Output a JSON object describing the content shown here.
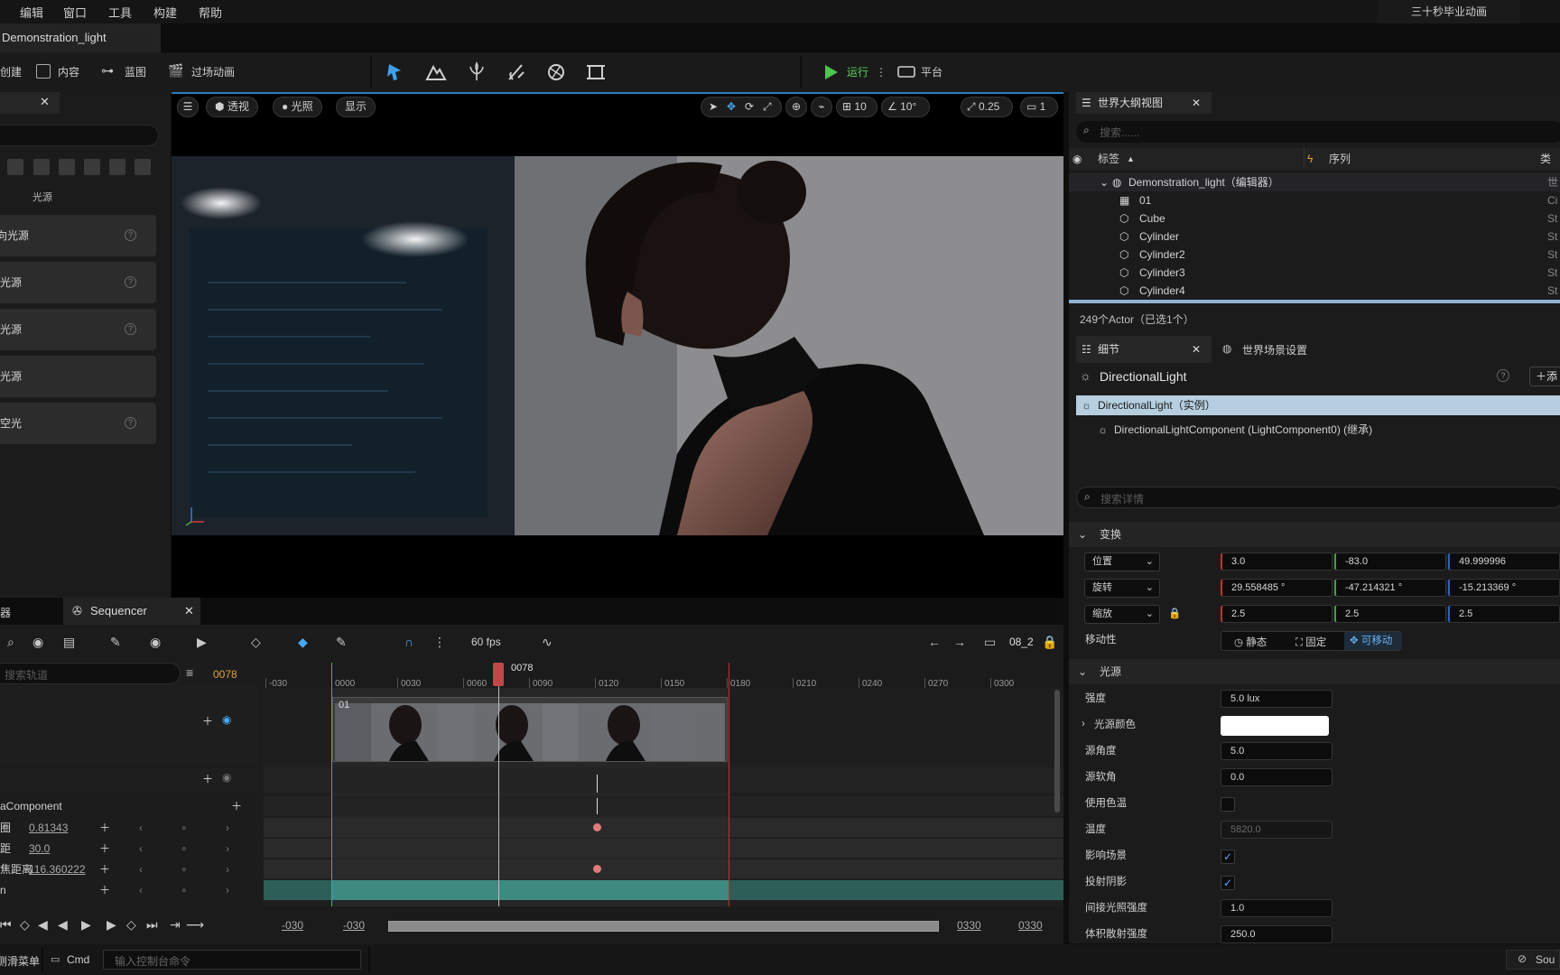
{
  "menu": {
    "items": [
      "编辑",
      "窗口",
      "工具",
      "构建",
      "帮助"
    ],
    "project_name": "三十秒毕业动画"
  },
  "document_tab": {
    "title": "Demonstration_light"
  },
  "toolbar": {
    "create_label": "创建",
    "content_label": "内容",
    "blueprint_label": "蓝图",
    "cinematics_label": "过场动画",
    "run_label": "运行",
    "platform_label": "平台"
  },
  "left_panel": {
    "category": "光源",
    "items": [
      {
        "label": "定向光源"
      },
      {
        "label": "点光源"
      },
      {
        "label": "聚光源"
      },
      {
        "label": "矩形光源"
      },
      {
        "label": "天空光"
      }
    ]
  },
  "viewport": {
    "perspective_label": "透视",
    "lighting_label": "光照",
    "show_label": "显示",
    "grid_value": "10",
    "angle_value": "10°",
    "scale_value": "0.25",
    "camera_speed": "1"
  },
  "outliner": {
    "tab_title": "世界大纲视图",
    "search_placeholder": "搜索......",
    "col_label": "标签",
    "col_sequence": "序列",
    "col_type": "类",
    "rows": [
      {
        "name": "Demonstration_light（编辑器）",
        "type": "世"
      },
      {
        "name": "01",
        "type": "Ci"
      },
      {
        "name": "Cube",
        "type": "St"
      },
      {
        "name": "Cylinder",
        "type": "St"
      },
      {
        "name": "Cylinder2",
        "type": "St"
      },
      {
        "name": "Cylinder3",
        "type": "St"
      },
      {
        "name": "Cylinder4",
        "type": "St"
      }
    ],
    "footer": "249个Actor（已选1个）"
  },
  "details": {
    "tab_details": "细节",
    "tab_world_settings": "世界场景设置",
    "actor_name": "DirectionalLight",
    "add_label": "添",
    "instance_label": "DirectionalLight（实例）",
    "component_label": "DirectionalLightComponent (LightComponent0) (继承)",
    "search_placeholder": "搜索详情",
    "transform_header": "变换",
    "location": {
      "label": "位置",
      "x": "3.0",
      "y": "-83.0",
      "z": "49.999996"
    },
    "rotation": {
      "label": "旋转",
      "x": "29.558485 °",
      "y": "-47.214321 °",
      "z": "-15.213369 °"
    },
    "scale": {
      "label": "缩放",
      "x": "2.5",
      "y": "2.5",
      "z": "2.5"
    },
    "mobility": {
      "label": "移动性",
      "static": "静态",
      "stationary": "固定",
      "movable": "可移动"
    },
    "light_header": "光源",
    "intensity": {
      "label": "强度",
      "value": "5.0 lux"
    },
    "light_color": {
      "label": "光源颜色"
    },
    "source_angle": {
      "label": "源角度",
      "value": "5.0"
    },
    "source_soft_angle": {
      "label": "源软角",
      "value": "0.0"
    },
    "use_temperature": {
      "label": "使用色温"
    },
    "temperature": {
      "label": "温度",
      "value": "5820.0"
    },
    "affects_world": {
      "label": "影响场景"
    },
    "cast_shadows": {
      "label": "投射阴影"
    },
    "indirect_intensity": {
      "label": "间接光照强度",
      "value": "1.0"
    },
    "volumetric_intensity": {
      "label": "体积散射强度",
      "value": "250.0"
    }
  },
  "sequencer": {
    "tab_title": "Sequencer",
    "left_tab": "器",
    "fps": "60 fps",
    "sequence_name": "08_2",
    "search_placeholder": "搜索轨道",
    "current_frame": "0078",
    "playhead_label": "0078",
    "ruler_labels": [
      "-030",
      "0000",
      "0030",
      "0060",
      "0090",
      "0120",
      "0150",
      "0180",
      "0210",
      "0240",
      "0270",
      "0300"
    ],
    "shot_label": "01",
    "component_row": "aComponent",
    "tracks": [
      {
        "name": "圈",
        "value": "0.81343"
      },
      {
        "name": "距",
        "value": "30.0"
      },
      {
        "name": "焦距离",
        "value": "116.360222"
      },
      {
        "name": "n",
        "value": ""
      }
    ],
    "range_start": "-030",
    "range_start2": "-030",
    "range_end": "0330",
    "range_end2": "0330"
  },
  "statusbar": {
    "menu_label": "内容侧滑菜单",
    "cmd_label": "Cmd",
    "console_placeholder": "输入控制台命令",
    "source_label": "Sou"
  }
}
